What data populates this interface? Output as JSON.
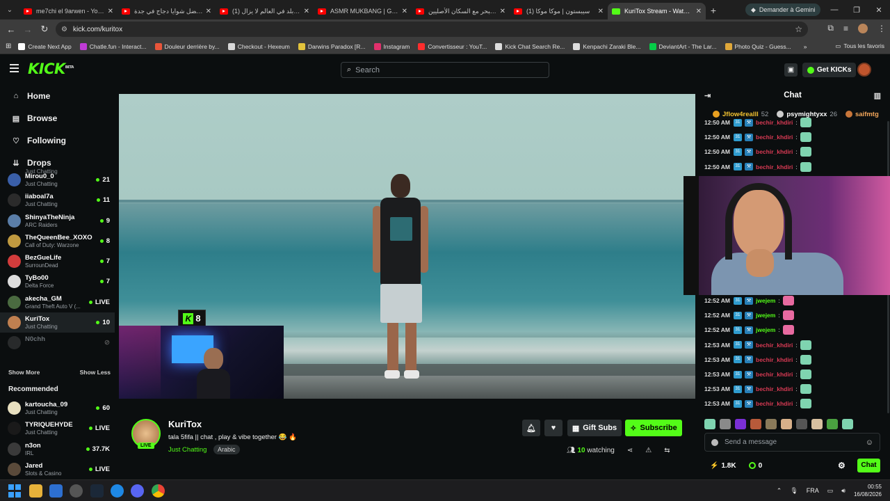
{
  "browser": {
    "tabs": [
      {
        "title": "me7chi el 9arwen - YouTube",
        "fav": "youtube"
      },
      {
        "title": "افضل شوايا دجاج في جدة 🍗",
        "fav": "youtube"
      },
      {
        "title": "(1) أجمل بلد في العالم لا يزال",
        "fav": "youtube"
      },
      {
        "title": "ASMR MUKBANG | GRILLED",
        "fav": "youtube"
      },
      {
        "title": "دخلت البحر مع السكان الأصليين",
        "fav": "youtube"
      },
      {
        "title": "(1) سيبستون | موكا موكا",
        "fav": "youtube"
      },
      {
        "title": "KuriTox Stream - Watch Live",
        "fav": "kick",
        "active": true
      }
    ],
    "gemini_label": "Demander à Gemini",
    "url": "kick.com/kuritox",
    "bookmarks": [
      {
        "label": "Create Next App",
        "color": "#ffffff"
      },
      {
        "label": "Chatle.fun - Interact...",
        "color": "#c03bd6"
      },
      {
        "label": "Douleur derrière by...",
        "color": "#e8553a"
      },
      {
        "label": "Checkout - Hexeum",
        "color": "#d8d8d8"
      },
      {
        "label": "Darwins Paradox [R...",
        "color": "#e2c33c"
      },
      {
        "label": "Instagram",
        "color": "#e1306c"
      },
      {
        "label": "Convertisseur : YouT...",
        "color": "#ff2d2d"
      },
      {
        "label": "Kick Chat Search Re...",
        "color": "#dddddd"
      },
      {
        "label": "Kenpachi Zaraki Ble...",
        "color": "#dddddd"
      },
      {
        "label": "DeviantArt - The Lar...",
        "color": "#05cc47"
      },
      {
        "label": "Photo Quiz - Guess...",
        "color": "#e0a83a"
      }
    ],
    "all_bookmarks": "Tous les favoris"
  },
  "header": {
    "logo": "KICK",
    "logo_sup": "BETA",
    "search_placeholder": "Search",
    "get_kicks": "Get KICKs"
  },
  "sidebar": {
    "nav": [
      {
        "label": "Home",
        "icon": "home-icon",
        "glyph": "⌂"
      },
      {
        "label": "Browse",
        "icon": "browse-icon",
        "glyph": "▤"
      },
      {
        "label": "Following",
        "icon": "heart-icon",
        "glyph": "♡"
      },
      {
        "label": "Drops",
        "icon": "drops-icon",
        "glyph": "⇊"
      }
    ],
    "cut_text": "Just Chatting",
    "following": [
      {
        "name": "Mirou0_0",
        "game": "Just Chatting",
        "viewers": "21",
        "color": "#3a5fa8"
      },
      {
        "name": "iiaboal7a",
        "game": "Just Chatting",
        "viewers": "11",
        "color": "#2b2b2b"
      },
      {
        "name": "ShinyaTheNinja",
        "game": "ARC Raiders",
        "viewers": "9",
        "color": "#5a7ea8"
      },
      {
        "name": "TheQueenBee_XOXO",
        "game": "Call of Duty: Warzone",
        "viewers": "8",
        "color": "#c09a40"
      },
      {
        "name": "BezGueLife",
        "game": "SurrounDead",
        "viewers": "7",
        "color": "#d23c3c"
      },
      {
        "name": "TyBo00",
        "game": "Delta Force",
        "viewers": "7",
        "color": "#dddddd"
      },
      {
        "name": "akecha_GM",
        "game": "Grand Theft Auto V (...",
        "viewers": "LIVE",
        "color": "#4a6a40"
      },
      {
        "name": "KuriTox",
        "game": "Just Chatting",
        "viewers": "10",
        "color": "#c08050",
        "active": true
      },
      {
        "name": "N0chh",
        "game": "",
        "viewers": "",
        "color": "#555555",
        "offline": true
      }
    ],
    "show_more": "Show More",
    "show_less": "Show Less",
    "recommended_title": "Recommended",
    "recommended": [
      {
        "name": "kartoucha_09",
        "game": "Just Chatting",
        "viewers": "60",
        "color": "#e8e0c0"
      },
      {
        "name": "TYRIQUEHYDE",
        "game": "Just Chatting",
        "viewers": "LIVE",
        "color": "#1a1a1a"
      },
      {
        "name": "n3on",
        "game": "IRL",
        "viewers": "37.7K",
        "color": "#3a3a3a"
      },
      {
        "name": "Jared",
        "game": "Slots & Casino",
        "viewers": "LIVE",
        "color": "#5a4a3a"
      }
    ]
  },
  "player": {
    "pip_count": "8"
  },
  "stream": {
    "name": "KuriTox",
    "live_label": "LIVE",
    "title": "tala 5fifa || chat , play & vibe together 😂 🔥",
    "category": "Just Chatting",
    "tag": "Arabic",
    "gift_subs": "Gift Subs",
    "subscribe": "Subscribe",
    "viewers": "10",
    "watching_label": "watching"
  },
  "chat": {
    "title": "Chat",
    "leaderboard": [
      {
        "name": "Jflow4realll",
        "count": "52",
        "color": "#f2c230",
        "coin": "#e8a020"
      },
      {
        "name": "psymightyxx",
        "count": "26",
        "color": "#ffffff",
        "coin": "#cccccc"
      },
      {
        "name": "saifmtg",
        "count": "",
        "color": "#f2a65a",
        "coin": "#c8763a"
      }
    ],
    "messages_top": [
      {
        "time": "12:50 AM",
        "user": "bechir_khdiri",
        "color": "#d93a54"
      },
      {
        "time": "12:50 AM",
        "user": "bechir_khdiri",
        "color": "#d93a54"
      },
      {
        "time": "12:50 AM",
        "user": "bechir_khdiri",
        "color": "#d93a54"
      },
      {
        "time": "12:50 AM",
        "user": "bechir_khdiri",
        "color": "#d93a54"
      }
    ],
    "messages_bottom": [
      {
        "time": "12:52 AM",
        "user": "jwejem",
        "color": "#53fc18",
        "emote": "#e86aa0"
      },
      {
        "time": "12:52 AM",
        "user": "jwejem",
        "color": "#53fc18",
        "emote": "#e86aa0"
      },
      {
        "time": "12:52 AM",
        "user": "jwejem",
        "color": "#53fc18",
        "emote": "#e86aa0"
      },
      {
        "time": "12:53 AM",
        "user": "bechir_khdiri",
        "color": "#d93a54",
        "emote": "#7fd4b0"
      },
      {
        "time": "12:53 AM",
        "user": "bechir_khdiri",
        "color": "#d93a54",
        "emote": "#7fd4b0"
      },
      {
        "time": "12:53 AM",
        "user": "bechir_khdiri",
        "color": "#d93a54",
        "emote": "#7fd4b0"
      },
      {
        "time": "12:53 AM",
        "user": "bechir_khdiri",
        "color": "#d93a54",
        "emote": "#7fd4b0"
      },
      {
        "time": "12:53 AM",
        "user": "bechir_khdiri",
        "color": "#d93a54",
        "emote": "#7fd4b0"
      }
    ],
    "emote_colors": [
      "#7fd4b0",
      "#8a8a8a",
      "#7a2fd6",
      "#b85a3a",
      "#8a7a5a",
      "#d8b08a",
      "#555555",
      "#d8c0a0",
      "#4aa040",
      "#7fd4b0"
    ],
    "input_placeholder": "Send a message",
    "kick_count": "1.8K",
    "points": "0",
    "send_label": "Chat"
  },
  "taskbar": {
    "lang": "FRA",
    "time": "00:55",
    "date": "16/08/2026"
  }
}
